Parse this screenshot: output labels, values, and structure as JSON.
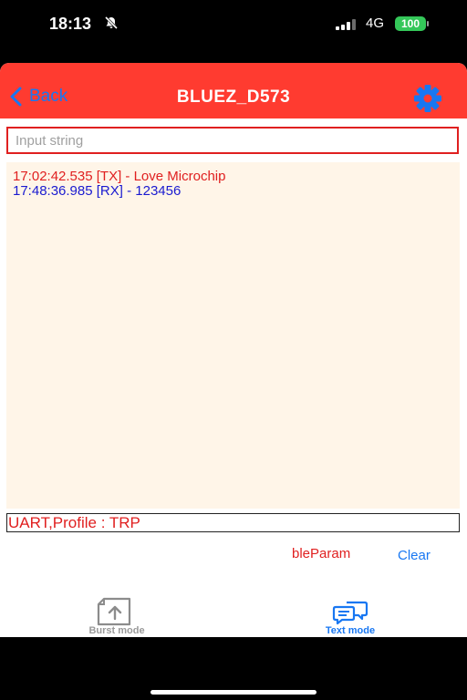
{
  "status_bar": {
    "time": "18:13",
    "network": "4G",
    "battery": "100"
  },
  "nav": {
    "back_label": "Back",
    "title": "BLUEZ_D573",
    "settings_icon": "gear-icon"
  },
  "input": {
    "placeholder": "Input string",
    "value": ""
  },
  "log": {
    "entries": [
      {
        "type": "TX",
        "text": "17:02:42.535 [TX] - Love Microchip",
        "color": "#e02020"
      },
      {
        "type": "RX",
        "text": "17:48:36.985 [RX] - 123456",
        "color": "#1a1ad0"
      }
    ]
  },
  "profile": "UART,Profile : TRP",
  "actions": {
    "ble_param": "bleParam",
    "clear": "Clear"
  },
  "tabs": [
    {
      "label": "Burst mode",
      "icon": "upload-icon",
      "active": false
    },
    {
      "label": "Text mode",
      "icon": "chat-icon",
      "active": true
    }
  ],
  "colors": {
    "accent": "#ff3b30",
    "link": "#1877f2",
    "log_bg": "#fff5e8"
  }
}
